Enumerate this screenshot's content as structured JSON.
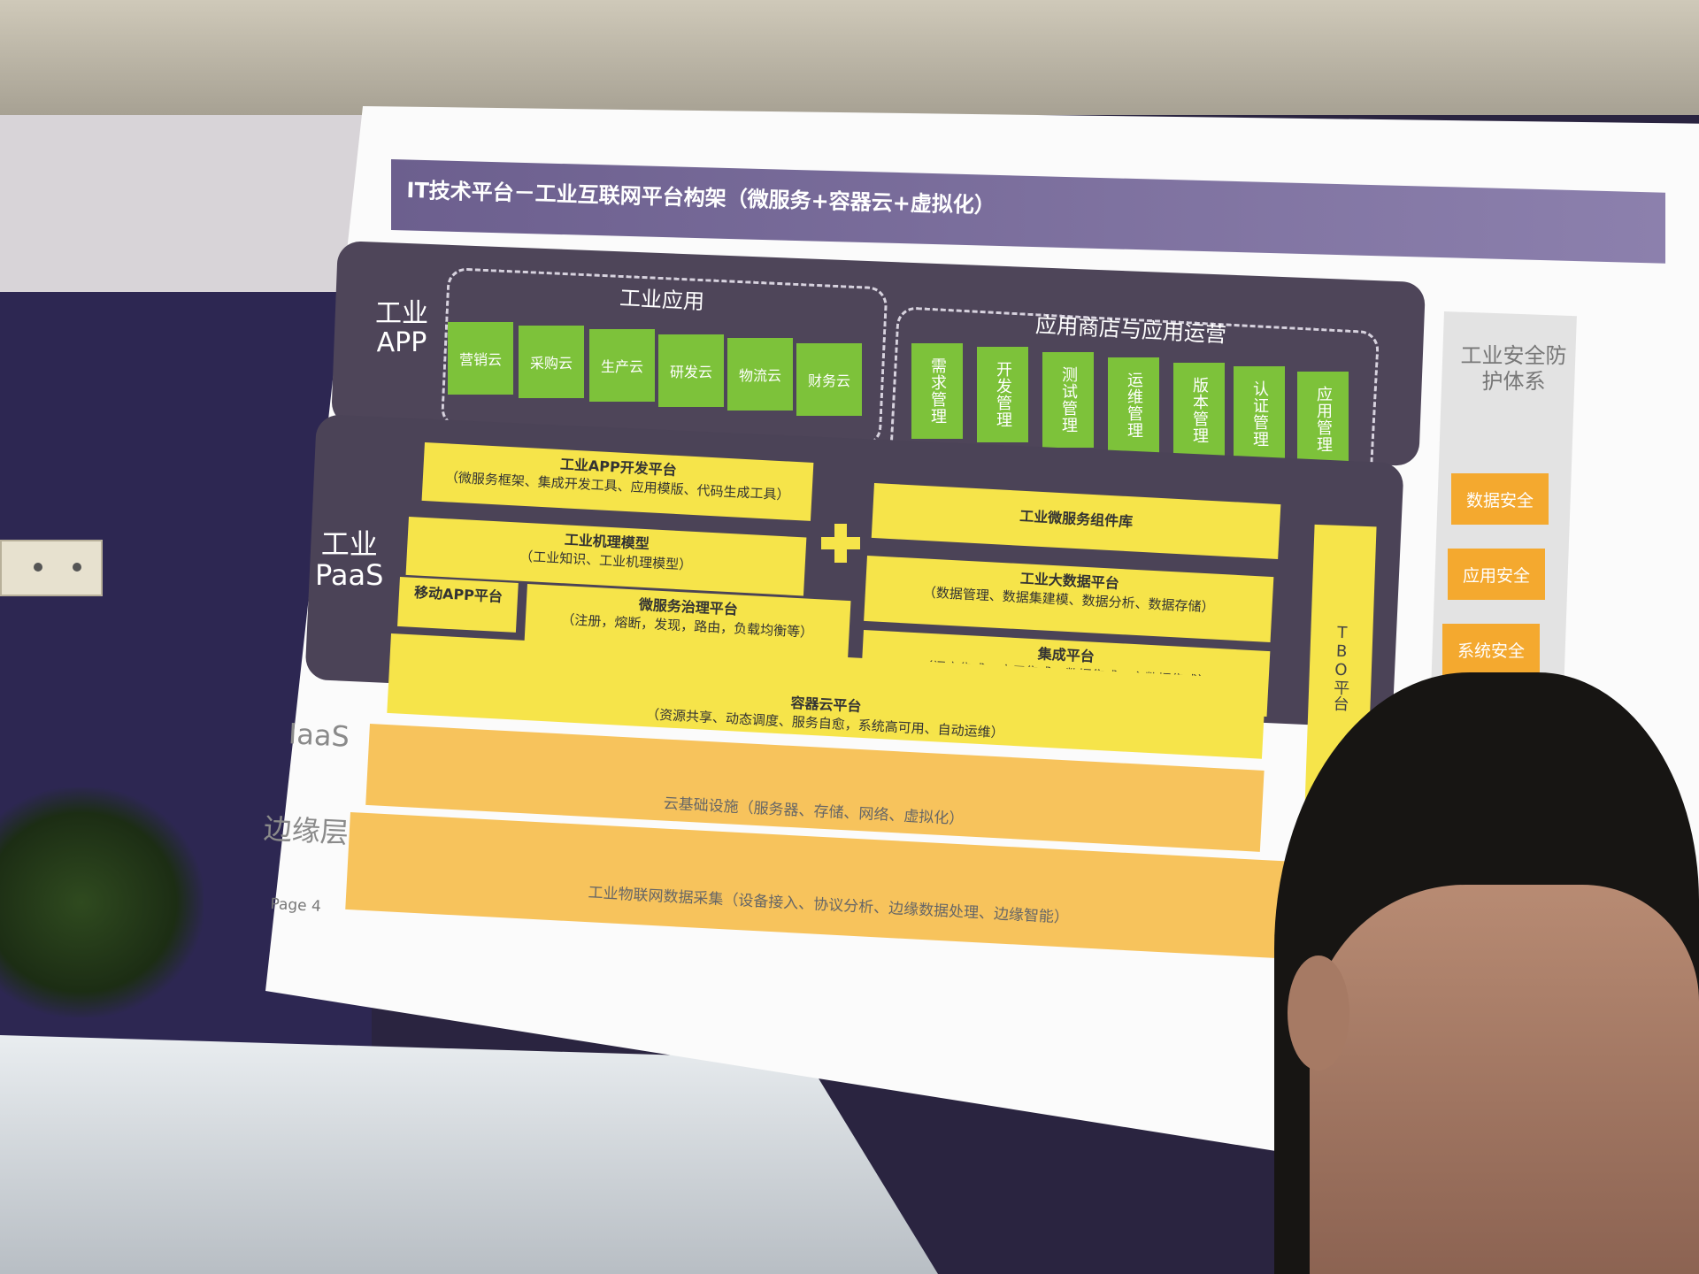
{
  "slide": {
    "title": "IT技术平台－工业互联网平台构架（微服务+容器云+虚拟化）",
    "page": "Page 4"
  },
  "app_layer": {
    "label_line1": "工业",
    "label_line2": "APP",
    "industrial_apps": {
      "heading": "工业应用",
      "items": [
        "营销云",
        "采购云",
        "生产云",
        "研发云",
        "物流云",
        "财务云"
      ]
    },
    "app_store": {
      "heading": "应用商店与应用运营",
      "items": [
        "需求管理",
        "开发管理",
        "测试管理",
        "运维管理",
        "版本管理",
        "认证管理",
        "应用管理"
      ]
    }
  },
  "paas_layer": {
    "label_line1": "工业",
    "label_line2": "PaaS",
    "app_dev_platform": {
      "title": "工业APP开发平台",
      "detail": "（微服务框架、集成开发工具、应用模版、代码生成工具）"
    },
    "mechanism_model": {
      "title": "工业机理模型",
      "detail": "（工业知识、工业机理模型）"
    },
    "mobile_app": {
      "title": "移动APP平台"
    },
    "microservice_gov": {
      "title": "微服务治理平台",
      "detail": "（注册，熔断，发现，路由，负载均衡等）"
    },
    "microservice_lib": {
      "title": "工业微服务组件库"
    },
    "big_data": {
      "title": "工业大数据平台",
      "detail": "（数据管理、数据集建模、数据分析、数据存储）"
    },
    "integration": {
      "title": "集成平台",
      "detail": "（门户集成、应用集成、数据集成、主数据集成）"
    },
    "container_cloud": {
      "title": "容器云平台",
      "detail": "（资源共享、动态调度、服务自愈，系统高可用、自动运维）"
    },
    "tbo": "TBO平台"
  },
  "iaas_layer": {
    "label": "IaaS",
    "text": "云基础设施（服务器、存储、网络、虚拟化）"
  },
  "edge_layer": {
    "label": "边缘层",
    "text": "工业物联网数据采集（设备接入、协议分析、边缘数据处理、边缘智能）"
  },
  "security": {
    "title": "工业安全防护体系",
    "items": [
      "数据安全",
      "应用安全",
      "系统安全"
    ]
  },
  "colors": {
    "layer_dark": "#4b4357",
    "green": "#7dc23a",
    "yellow": "#f6e44a",
    "orange": "#f7c35c",
    "security_orange": "#f4a92f",
    "title_purple": "#6c5f8e"
  }
}
